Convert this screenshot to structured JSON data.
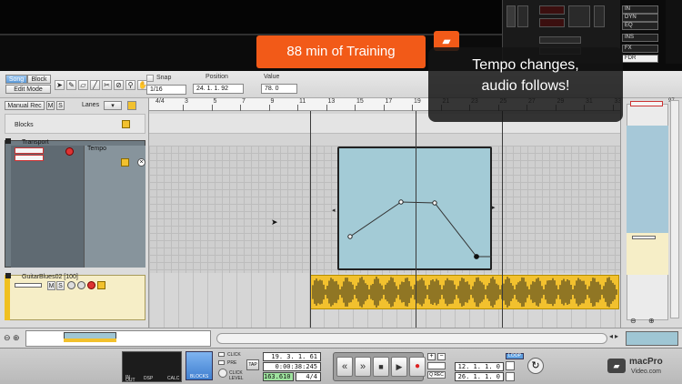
{
  "promo": {
    "training_banner": "88 min of Training",
    "callout_line1": "Tempo changes,",
    "callout_line2": "audio follows!",
    "watermark_top": "macPro",
    "watermark_bottom": "Video.com"
  },
  "mixer": {
    "labels": [
      "IN",
      "DYN",
      "EQ",
      "INS",
      "FX",
      "FDR"
    ]
  },
  "toolbar": {
    "song_label": "Song",
    "block_label": "Block",
    "edit_mode_label": "Edit Mode",
    "snap_label": "Snap",
    "snap_value": "1/16",
    "position_label": "Position",
    "position_value": "24. 1. 1. 92",
    "value_label": "Value",
    "value_value": "78.   0"
  },
  "left_panel": {
    "manual_rec_label": "Manual Rec",
    "m_label": "M",
    "s_label": "S",
    "lanes_label": "Lanes",
    "blocks_label": "Blocks",
    "transport_label": "Transport",
    "tempo_label": "Tempo",
    "guitar_track_name": "GuitarBlues02 [100]"
  },
  "ruler": {
    "ticks": [
      "3",
      "5",
      "7",
      "9",
      "11",
      "13",
      "15",
      "17",
      "19",
      "21",
      "23",
      "25",
      "27",
      "29",
      "31",
      "33"
    ],
    "time_signature": "4/4",
    "right_number": "97"
  },
  "transport": {
    "click_label": "CLICK",
    "pre_label": "PRE",
    "click_level_label": "CLICK LEVEL",
    "tap_label": "TAP",
    "blocks_label": "BLOCKS",
    "in_label": "IN",
    "out_label": "OUT",
    "dsp_label": "DSP",
    "calc_label": "CALC",
    "position_bars": "19. 3. 1. 61",
    "position_time": "0:00:38:245",
    "tempo": "163.610",
    "signature": "4/4",
    "loop_label": "LOOP",
    "qrec_label": "Q REC",
    "loop_left": "12. 1. 1.  0",
    "loop_right": "26. 1. 1.  0"
  }
}
